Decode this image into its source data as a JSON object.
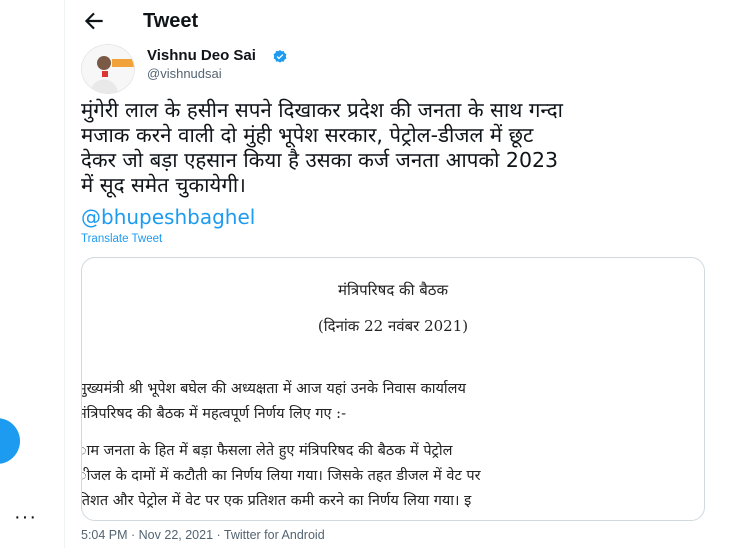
{
  "header": {
    "title": "Tweet"
  },
  "tweet": {
    "author_name": "Vishnu Deo Sai",
    "author_handle": "@vishnudsai",
    "text_lines": [
      "मुंगेरी लाल के हसीन सपने दिखाकर प्रदेश की जनता के साथ गन्दा",
      "मजाक करने वाली दो मुंही भूपेश सरकार, पेट्रोल-डीजल में छूट",
      "देकर जो बड़ा एहसान किया है उसका कर्ज जनता आपको 2023",
      "में सूद समेत चुकायेगी।"
    ],
    "mention": "@bhupeshbaghel",
    "translate_label": "Translate Tweet",
    "timestamp": "5:04 PM · Nov 22, 2021 · Twitter for Android"
  },
  "media": {
    "doc_title": "मंत्रिपरिषद की बैठक",
    "doc_date": "(दिनांक 22 नवंबर 2021)",
    "paragraph1": [
      "मुख्यमंत्री श्री भूपेश बघेल की अध्यक्षता में आज यहां उनके निवास कार्यालय",
      "मंत्रिपरिषद की बैठक में महत्वपूर्ण निर्णय लिए गए :-"
    ],
    "paragraph2": [
      "ाम जनता के हित में बड़ा फैसला लेते हुए मंत्रिपरिषद की बैठक में पेट्रोल",
      "ीजल के दामों में कटौती का निर्णय लिया गया। जिसके तहत डीजल में वेट पर",
      "तिशत और पेट्रोल में वेट पर एक प्रतिशत कमी करने का निर्णय लिया गया। इ"
    ]
  },
  "icons": {
    "back": "arrow-left-icon",
    "verified": "verified-badge-icon",
    "more": "more-dots-icon"
  },
  "colors": {
    "accent": "#1d9bf0",
    "text": "#0f1419",
    "secondary": "#536471"
  }
}
